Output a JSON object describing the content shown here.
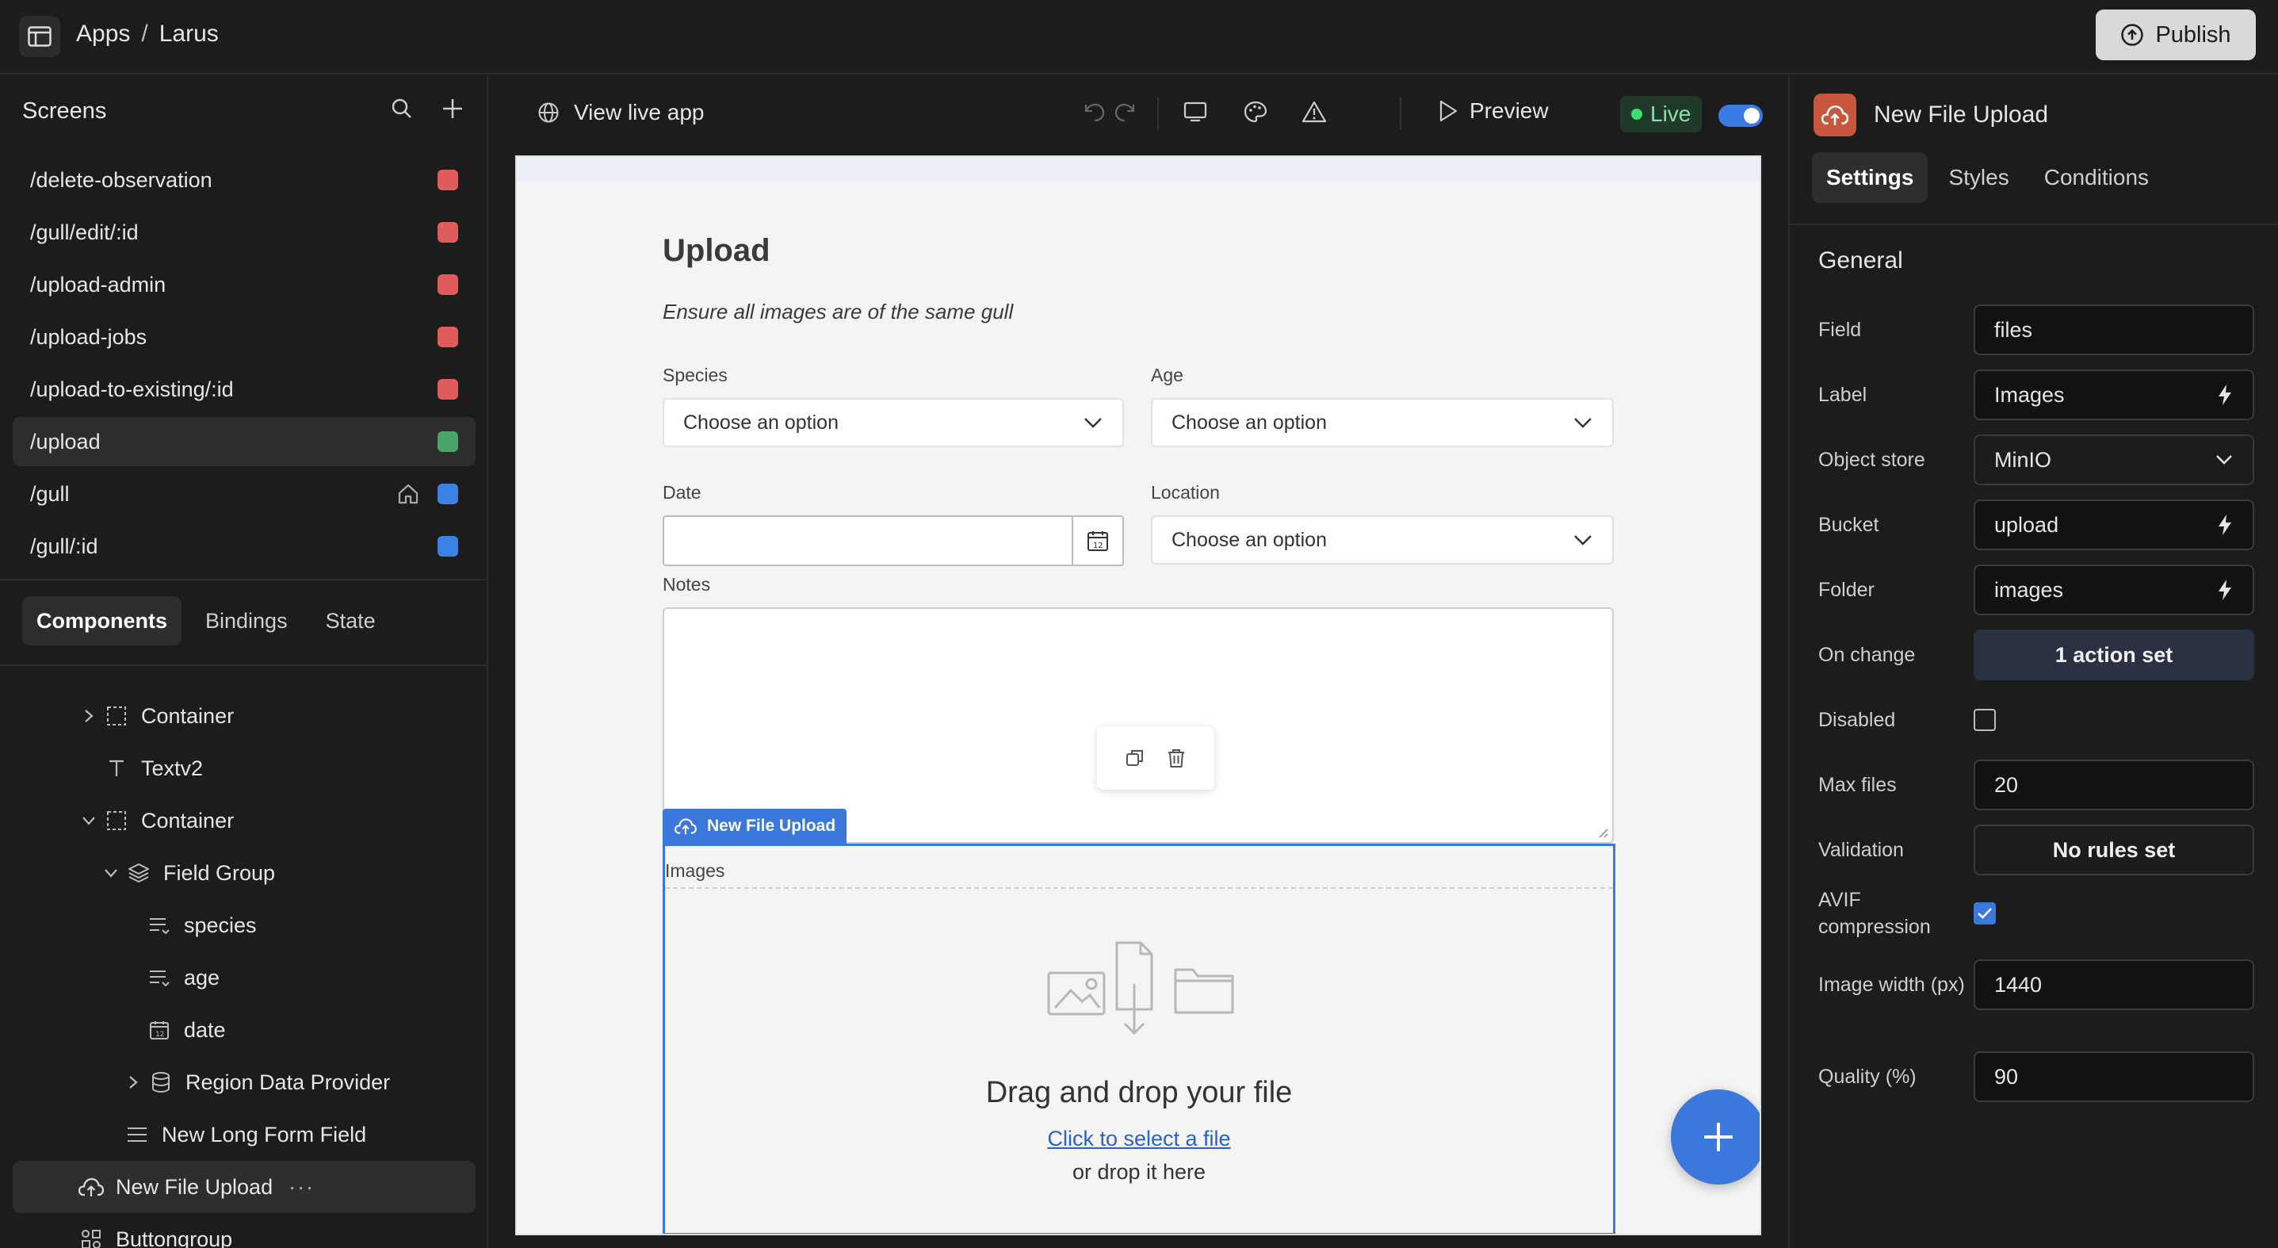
{
  "topbar": {
    "breadcrumb": [
      "Apps",
      "Larus"
    ],
    "breadcrumb_sep": "/",
    "publish_label": "Publish"
  },
  "screens": {
    "title": "Screens",
    "items": [
      {
        "label": "/delete-observation",
        "color": "#e05c5c",
        "home": false
      },
      {
        "label": "/gull/edit/:id",
        "color": "#e05c5c",
        "home": false
      },
      {
        "label": "/upload-admin",
        "color": "#e05c5c",
        "home": false
      },
      {
        "label": "/upload-jobs",
        "color": "#e05c5c",
        "home": false
      },
      {
        "label": "/upload-to-existing/:id",
        "color": "#e05c5c",
        "home": false
      },
      {
        "label": "/upload",
        "color": "#4aa56a",
        "home": false,
        "active": true
      },
      {
        "label": "/gull",
        "color": "#3b82e6",
        "home": true
      },
      {
        "label": "/gull/:id",
        "color": "#3b82e6",
        "home": false
      }
    ]
  },
  "panel_tabs": [
    "Components",
    "Bindings",
    "State"
  ],
  "tree": [
    {
      "label": "Container",
      "indent": 1,
      "chev": "right",
      "icon": "container-icon"
    },
    {
      "label": "Textv2",
      "indent": 1,
      "chev": "",
      "icon": "text-icon"
    },
    {
      "label": "Container",
      "indent": 1,
      "chev": "down",
      "icon": "container-icon"
    },
    {
      "label": "Field Group",
      "indent": 2,
      "chev": "down",
      "icon": "layers-icon"
    },
    {
      "label": "species",
      "indent": 3,
      "chev": "",
      "icon": "list-icon"
    },
    {
      "label": "age",
      "indent": 3,
      "chev": "",
      "icon": "list-icon"
    },
    {
      "label": "date",
      "indent": 3,
      "chev": "",
      "icon": "calendar-icon"
    },
    {
      "label": "Region Data Provider",
      "indent": 3,
      "chev": "right",
      "icon": "database-icon"
    },
    {
      "label": "New Long Form Field",
      "indent": 2,
      "chev": "",
      "icon": "lines-icon"
    },
    {
      "label": "New File Upload",
      "indent": 0,
      "chev": "",
      "icon": "cloud-upload-icon",
      "selected": true
    },
    {
      "label": "Buttongroup",
      "indent": 0,
      "chev": "",
      "icon": "buttongroup-icon"
    }
  ],
  "center_toolbar": {
    "view_live": "View live app",
    "preview": "Preview",
    "live": "Live"
  },
  "app": {
    "title": "Upload",
    "subtitle": "Ensure all images are of the same gull",
    "species_label": "Species",
    "age_label": "Age",
    "date_label": "Date",
    "location_label": "Location",
    "notes_label": "Notes",
    "select_placeholder": "Choose an option",
    "component_badge": "New File Upload",
    "upload_label": "Images",
    "drop_title": "Drag and drop your file",
    "drop_link": "Click to select a file",
    "drop_sub": "or drop it here"
  },
  "settings": {
    "component_title": "New File Upload",
    "tabs": [
      "Settings",
      "Styles",
      "Conditions"
    ],
    "section": "General",
    "field_label": "Field",
    "field_value": "files",
    "label_label": "Label",
    "label_value": "Images",
    "object_store_label": "Object store",
    "object_store_value": "MinIO",
    "bucket_label": "Bucket",
    "bucket_value": "upload",
    "folder_label": "Folder",
    "folder_value": "images",
    "on_change_label": "On change",
    "on_change_value": "1 action set",
    "disabled_label": "Disabled",
    "disabled_checked": false,
    "max_files_label": "Max files",
    "max_files_value": "20",
    "validation_label": "Validation",
    "validation_value": "No rules set",
    "avif_label": "AVIF compression",
    "avif_checked": true,
    "image_width_label": "Image width (px)",
    "image_width_value": "1440",
    "quality_label": "Quality (%)",
    "quality_value": "90"
  },
  "colors": {
    "accent": "#3b78dc",
    "live_green": "#3ddc6f",
    "component_icon": "#c8553d"
  }
}
